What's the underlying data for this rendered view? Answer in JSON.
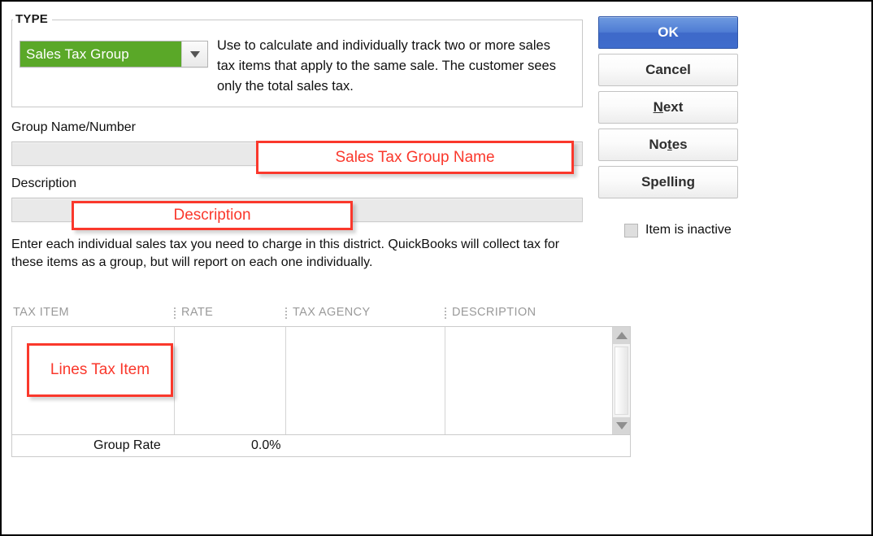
{
  "type_section": {
    "legend": "TYPE",
    "selected_value": "Sales Tax Group",
    "dropdown_color": "#5aa828",
    "description": "Use to calculate and individually track two or more sales tax items that apply to the same sale. The customer sees only the total sales tax."
  },
  "fields": {
    "group_name_label": "Group Name/Number",
    "group_name_value": "",
    "description_label": "Description",
    "description_value": ""
  },
  "instructions": "Enter each individual sales tax you need to charge in this district.  QuickBooks will collect tax for these items as a group, but will report on each one individually.",
  "buttons": {
    "ok": "OK",
    "cancel": "Cancel",
    "next_pre": "",
    "next_accel": "N",
    "next_post": "ext",
    "notes_pre": "No",
    "notes_accel": "t",
    "notes_post": "es",
    "spelling_pre": "Spellin",
    "spelling_accel": "g",
    "spelling_post": ""
  },
  "inactive_checkbox": {
    "label": "Item is inactive",
    "checked": false,
    "enabled": false
  },
  "table": {
    "columns": [
      "TAX ITEM",
      "RATE",
      "TAX AGENCY",
      "DESCRIPTION"
    ],
    "rows": [],
    "footer_label": "Group Rate",
    "footer_value": "0.0%"
  },
  "annotations": {
    "color": "#fa382c",
    "group_name": "Sales Tax Group Name",
    "description": "Description",
    "lines": "Lines Tax Item"
  }
}
